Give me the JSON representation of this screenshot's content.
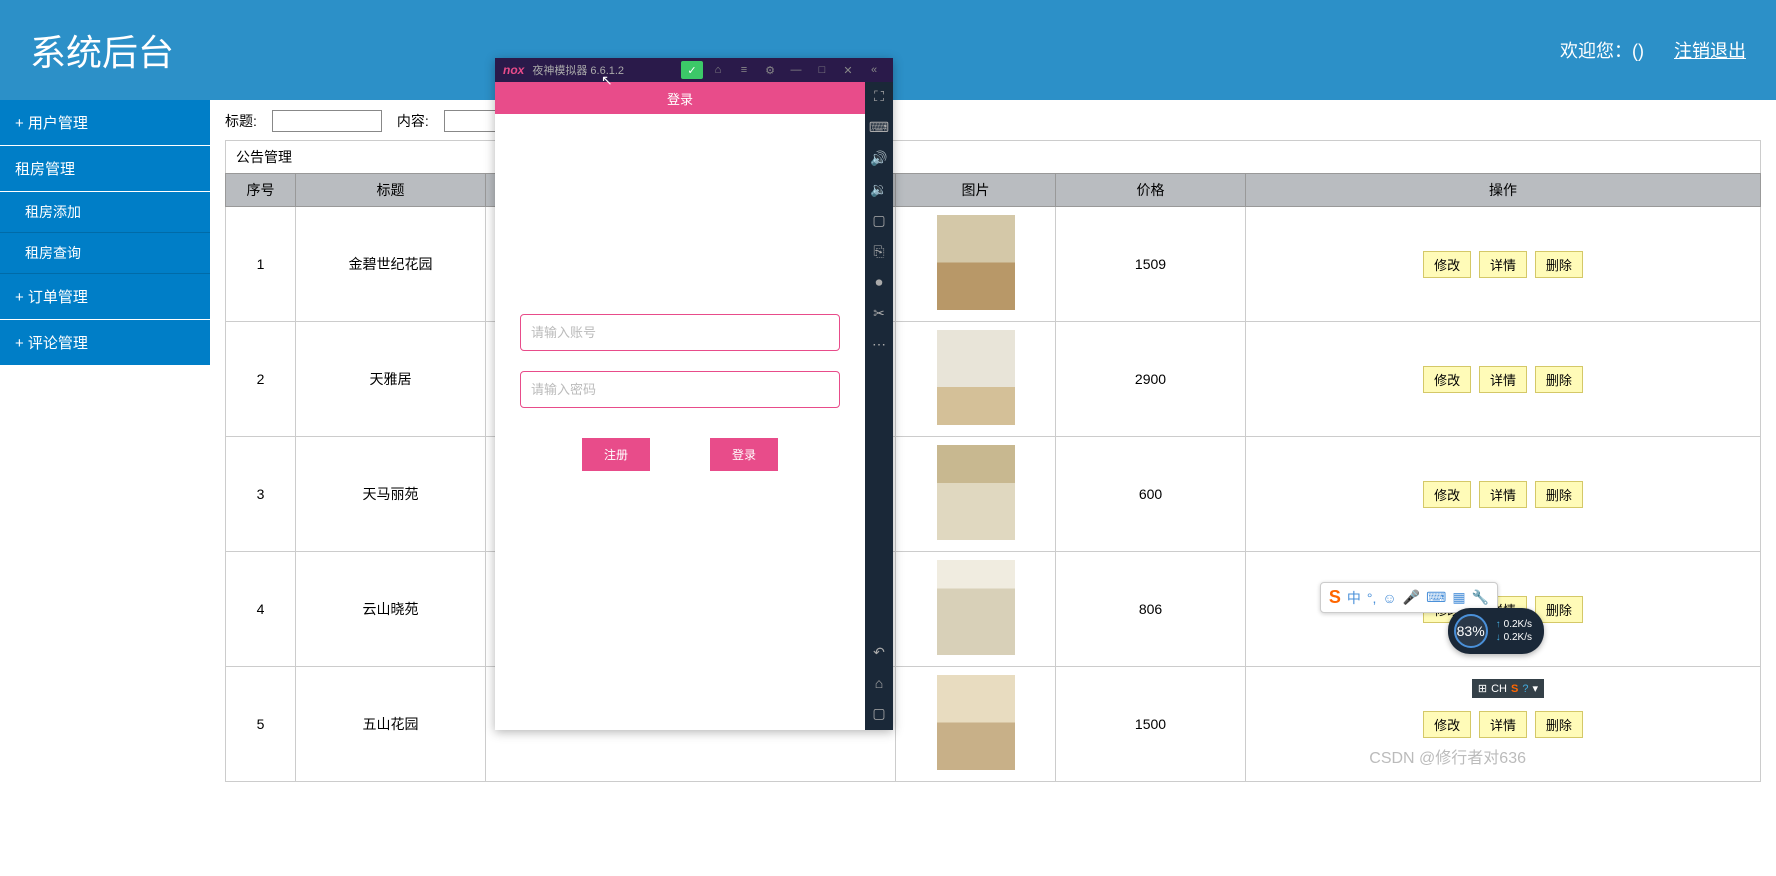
{
  "header": {
    "title": "系统后台",
    "welcome": "欢迎您：()",
    "logout": "注销退出"
  },
  "sidebar": {
    "items": [
      {
        "label": "+  用户管理",
        "sub": []
      },
      {
        "label": "    租房管理",
        "sub": [
          "租房添加",
          "租房查询"
        ]
      },
      {
        "label": "+  订单管理",
        "sub": []
      },
      {
        "label": "+  评论管理",
        "sub": []
      }
    ]
  },
  "filters": {
    "label_title": "标题:",
    "label_content": "内容:"
  },
  "panel_title": "公告管理",
  "columns": {
    "idx": "序号",
    "title": "标题",
    "img": "图片",
    "price": "价格",
    "action": "操作"
  },
  "rows": [
    {
      "idx": "1",
      "title": "金碧世纪花园",
      "price": "1509"
    },
    {
      "idx": "2",
      "title": "天雅居",
      "price": "2900"
    },
    {
      "idx": "3",
      "title": "天马丽苑",
      "price": "600"
    },
    {
      "idx": "4",
      "title": "云山晓苑",
      "price": "806"
    },
    {
      "idx": "5",
      "title": "五山花园",
      "price": "1500"
    }
  ],
  "actions": {
    "edit": "修改",
    "detail": "详情",
    "delete": "删除"
  },
  "emulator": {
    "brand": "nox",
    "title": "夜神模拟器 6.6.1.2",
    "app_header": "登录",
    "username_ph": "请输入账号",
    "password_ph": "请输入密码",
    "btn_register": "注册",
    "btn_login": "登录"
  },
  "ime": {
    "brand": "S",
    "lang": "中"
  },
  "speed": {
    "percent": "83%",
    "up": "0.2K/s",
    "down": "0.2K/s"
  },
  "taskbar": {
    "lang": "CH"
  },
  "watermark": "CSDN @修行者对636"
}
